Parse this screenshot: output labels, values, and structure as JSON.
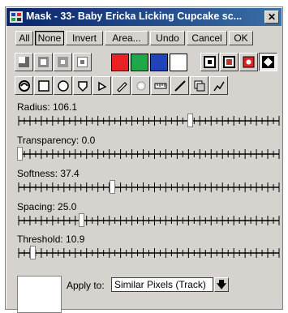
{
  "window": {
    "title": "Mask - 33- Baby Ericka Licking Cupcake sc..."
  },
  "buttons": [
    "All",
    "None",
    "Invert",
    "Area...",
    "Undo",
    "Cancel",
    "OK"
  ],
  "colors": {
    "swatch_red": "#e82222",
    "swatch_green": "#1ea84a",
    "swatch_blue": "#1e44b8",
    "swatch_white": "#ffffff"
  },
  "sliders": [
    {
      "label": "Radius: 106.1",
      "fraction": 0.66
    },
    {
      "label": "Transparency: 0.0",
      "fraction": 0.0
    },
    {
      "label": "Softness: 37.4",
      "fraction": 0.36
    },
    {
      "label": "Spacing: 25.0",
      "fraction": 0.24
    },
    {
      "label": "Threshold: 10.9",
      "fraction": 0.05
    }
  ],
  "apply": {
    "label": "Apply to:",
    "value": "Similar Pixels (Track)"
  }
}
